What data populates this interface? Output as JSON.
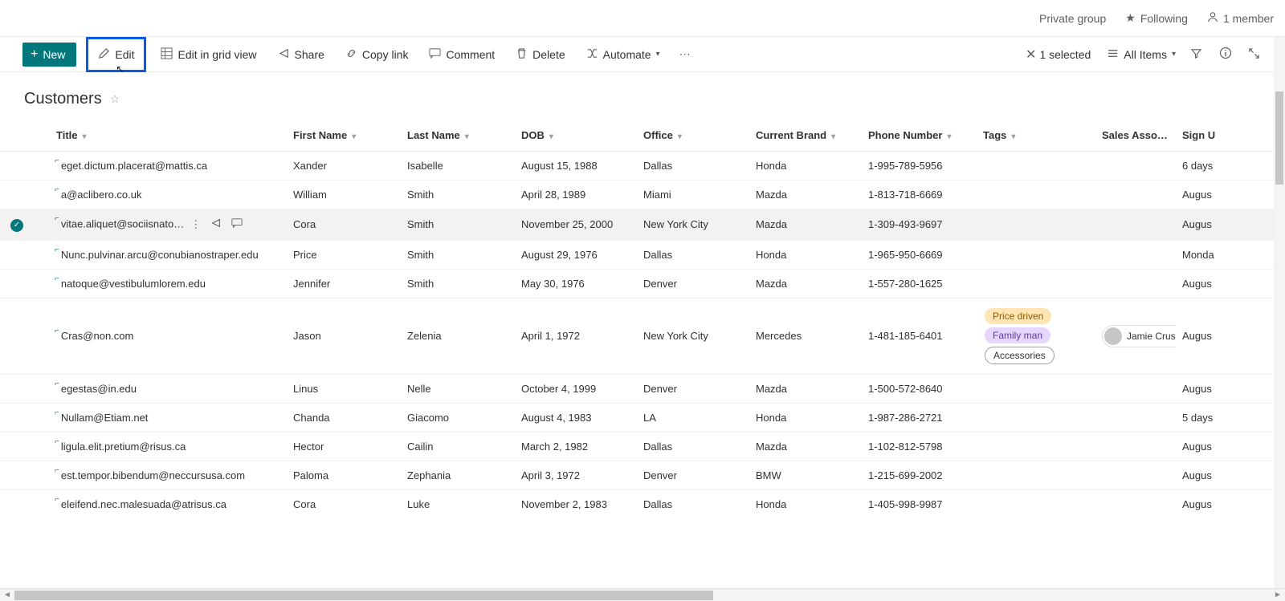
{
  "topbar": {
    "group_label": "Private group",
    "following_label": "Following",
    "members_label": "1 member"
  },
  "cmdbar": {
    "new": "New",
    "edit": "Edit",
    "edit_grid": "Edit in grid view",
    "share": "Share",
    "copy_link": "Copy link",
    "comment": "Comment",
    "delete": "Delete",
    "automate": "Automate",
    "selected": "1 selected",
    "view_name": "All Items"
  },
  "page_title": "Customers",
  "columns": {
    "title": "Title",
    "first_name": "First Name",
    "last_name": "Last Name",
    "dob": "DOB",
    "office": "Office",
    "brand": "Current Brand",
    "phone": "Phone Number",
    "tags": "Tags",
    "associate": "Sales Associate",
    "signup": "Sign U"
  },
  "rows": [
    {
      "selected": false,
      "title": "eget.dictum.placerat@mattis.ca",
      "first_name": "Xander",
      "last_name": "Isabelle",
      "dob": "August 15, 1988",
      "office": "Dallas",
      "brand": "Honda",
      "phone": "1-995-789-5956",
      "tags": [],
      "associate": "",
      "signup": "6 days"
    },
    {
      "selected": false,
      "title": "a@aclibero.co.uk",
      "first_name": "William",
      "last_name": "Smith",
      "dob": "April 28, 1989",
      "office": "Miami",
      "brand": "Mazda",
      "phone": "1-813-718-6669",
      "tags": [],
      "associate": "",
      "signup": "Augus"
    },
    {
      "selected": true,
      "title": "vitae.aliquet@sociisnato…",
      "first_name": "Cora",
      "last_name": "Smith",
      "dob": "November 25, 2000",
      "office": "New York City",
      "brand": "Mazda",
      "phone": "1-309-493-9697",
      "tags": [],
      "associate": "",
      "signup": "Augus"
    },
    {
      "selected": false,
      "title": "Nunc.pulvinar.arcu@conubianostraper.edu",
      "first_name": "Price",
      "last_name": "Smith",
      "dob": "August 29, 1976",
      "office": "Dallas",
      "brand": "Honda",
      "phone": "1-965-950-6669",
      "tags": [],
      "associate": "",
      "signup": "Monda"
    },
    {
      "selected": false,
      "title": "natoque@vestibulumlorem.edu",
      "first_name": "Jennifer",
      "last_name": "Smith",
      "dob": "May 30, 1976",
      "office": "Denver",
      "brand": "Mazda",
      "phone": "1-557-280-1625",
      "tags": [],
      "associate": "",
      "signup": "Augus"
    },
    {
      "selected": false,
      "title": "Cras@non.com",
      "first_name": "Jason",
      "last_name": "Zelenia",
      "dob": "April 1, 1972",
      "office": "New York City",
      "brand": "Mercedes",
      "phone": "1-481-185-6401",
      "tags": [
        "Price driven",
        "Family man",
        "Accessories"
      ],
      "associate": "Jamie Crust",
      "signup": "Augus"
    },
    {
      "selected": false,
      "title": "egestas@in.edu",
      "first_name": "Linus",
      "last_name": "Nelle",
      "dob": "October 4, 1999",
      "office": "Denver",
      "brand": "Mazda",
      "phone": "1-500-572-8640",
      "tags": [],
      "associate": "",
      "signup": "Augus"
    },
    {
      "selected": false,
      "title": "Nullam@Etiam.net",
      "first_name": "Chanda",
      "last_name": "Giacomo",
      "dob": "August 4, 1983",
      "office": "LA",
      "brand": "Honda",
      "phone": "1-987-286-2721",
      "tags": [],
      "associate": "",
      "signup": "5 days"
    },
    {
      "selected": false,
      "title": "ligula.elit.pretium@risus.ca",
      "first_name": "Hector",
      "last_name": "Cailin",
      "dob": "March 2, 1982",
      "office": "Dallas",
      "brand": "Mazda",
      "phone": "1-102-812-5798",
      "tags": [],
      "associate": "",
      "signup": "Augus"
    },
    {
      "selected": false,
      "title": "est.tempor.bibendum@neccursusa.com",
      "first_name": "Paloma",
      "last_name": "Zephania",
      "dob": "April 3, 1972",
      "office": "Denver",
      "brand": "BMW",
      "phone": "1-215-699-2002",
      "tags": [],
      "associate": "",
      "signup": "Augus"
    },
    {
      "selected": false,
      "title": "eleifend.nec.malesuada@atrisus.ca",
      "first_name": "Cora",
      "last_name": "Luke",
      "dob": "November 2, 1983",
      "office": "Dallas",
      "brand": "Honda",
      "phone": "1-405-998-9987",
      "tags": [],
      "associate": "",
      "signup": "Augus"
    }
  ]
}
